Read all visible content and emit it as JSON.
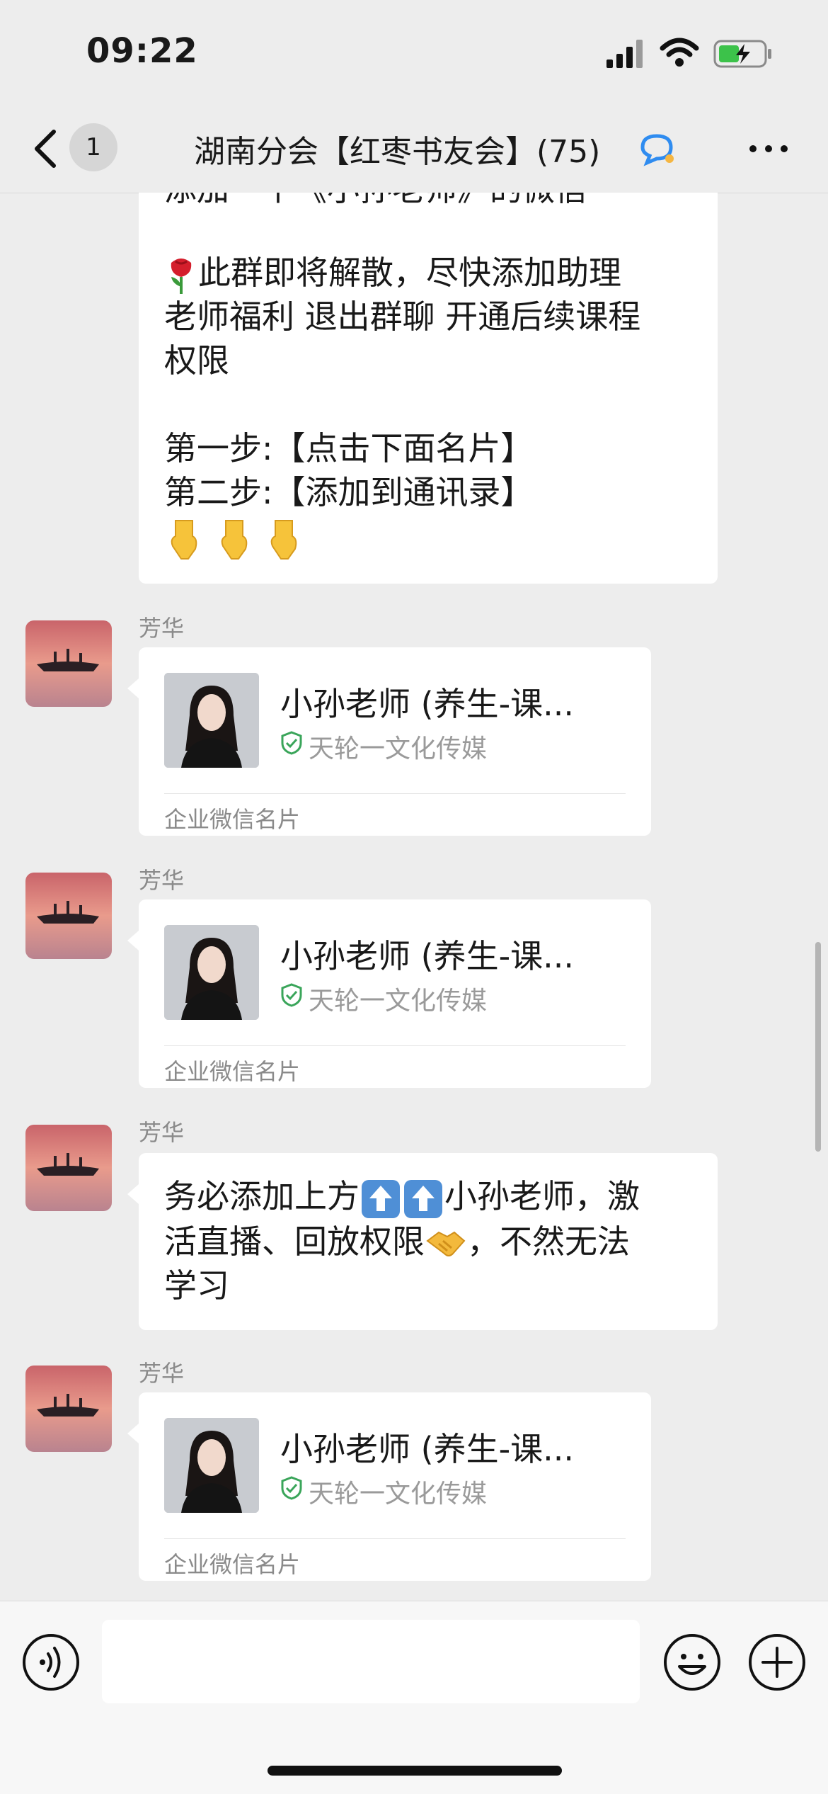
{
  "status": {
    "time": "09:22"
  },
  "nav": {
    "unread_count": "1",
    "title": "湖南分会【红枣书友会】(75)"
  },
  "top_message": {
    "partial_line": "添加一个《小孙老师》的微信",
    "line1": "此群即将解散，尽快添加助理",
    "line2": "老师福利 退出群聊 开通后续课程",
    "line3": "权限",
    "line4": "第一步:【点击下面名片】",
    "line5": "第二步:【添加到通讯录】",
    "pointers": "👇 👇 👇",
    "rose_icon": "rose-icon"
  },
  "messages": [
    {
      "sender": "芳华",
      "type": "card",
      "card_name": "小孙老师 (养生-课...",
      "card_company": "天轮一文化传媒",
      "card_footer": "企业微信名片"
    },
    {
      "sender": "芳华",
      "type": "card",
      "card_name": "小孙老师 (养生-课...",
      "card_company": "天轮一文化传媒",
      "card_footer": "企业微信名片"
    },
    {
      "sender": "芳华",
      "type": "text",
      "line1_a": "务必添加上方",
      "line1_b": "小孙老师，激",
      "line2_a": "活直播、回放权限",
      "line2_b": "，不然无法",
      "line3": "学习"
    },
    {
      "sender": "芳华",
      "type": "card",
      "card_name": "小孙老师 (养生-课...",
      "card_company": "天轮一文化传媒",
      "card_footer": "企业微信名片"
    }
  ],
  "input": {
    "placeholder": ""
  },
  "colors": {
    "background": "#ededed",
    "verified_green": "#3aa55a",
    "bubble": "#ffffff"
  }
}
